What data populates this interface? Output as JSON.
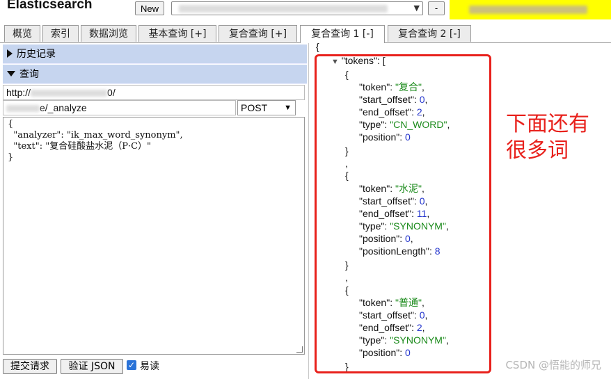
{
  "header": {
    "app_title": "Elasticsearch",
    "new_button": "New",
    "small_button": "-"
  },
  "tabs": [
    {
      "label": "概览"
    },
    {
      "label": "索引"
    },
    {
      "label": "数据浏览"
    },
    {
      "label": "基本查询 [+]"
    },
    {
      "label": "复合查询 [+]"
    },
    {
      "label": "复合查询 1 [-]",
      "active": true
    },
    {
      "label": "复合查询 2 [-]"
    }
  ],
  "left": {
    "history_label": "历史记录",
    "query_label": "查询",
    "url_value": "http://",
    "url_suffix": "0/",
    "path_value": "e/_analyze",
    "method": "POST",
    "editor_lines": [
      "{",
      "  \"analyzer\": \"ik_max_word_synonym\",",
      "  \"text\": \"复合硅酸盐水泥（P·C）\"",
      "}"
    ],
    "submit_button": "提交请求",
    "validate_button": "验证 JSON",
    "pretty_label": "易读",
    "pretty_checked": true
  },
  "response": {
    "open_brace": "{",
    "tokens_key": "\"tokens\": [",
    "tokens": [
      {
        "token": "复合",
        "start_offset": "0",
        "end_offset": "2",
        "type": "CN_WORD",
        "position": "0"
      },
      {
        "token": "水泥",
        "start_offset": "0",
        "end_offset": "11",
        "type": "SYNONYM",
        "position": "0",
        "positionLength": "8"
      },
      {
        "token": "普通",
        "start_offset": "0",
        "end_offset": "2",
        "type": "SYNONYM",
        "position": "0"
      }
    ]
  },
  "annotation": {
    "line1": "下面还有",
    "line2": "很多词"
  },
  "watermark": "CSDN @悟能的师兄",
  "colors": {
    "section_bg": "#c6d5ef",
    "string": "#1a8a1a",
    "number": "#2233cc",
    "annotation": "#e8211c",
    "highlight": "#ffff00"
  }
}
